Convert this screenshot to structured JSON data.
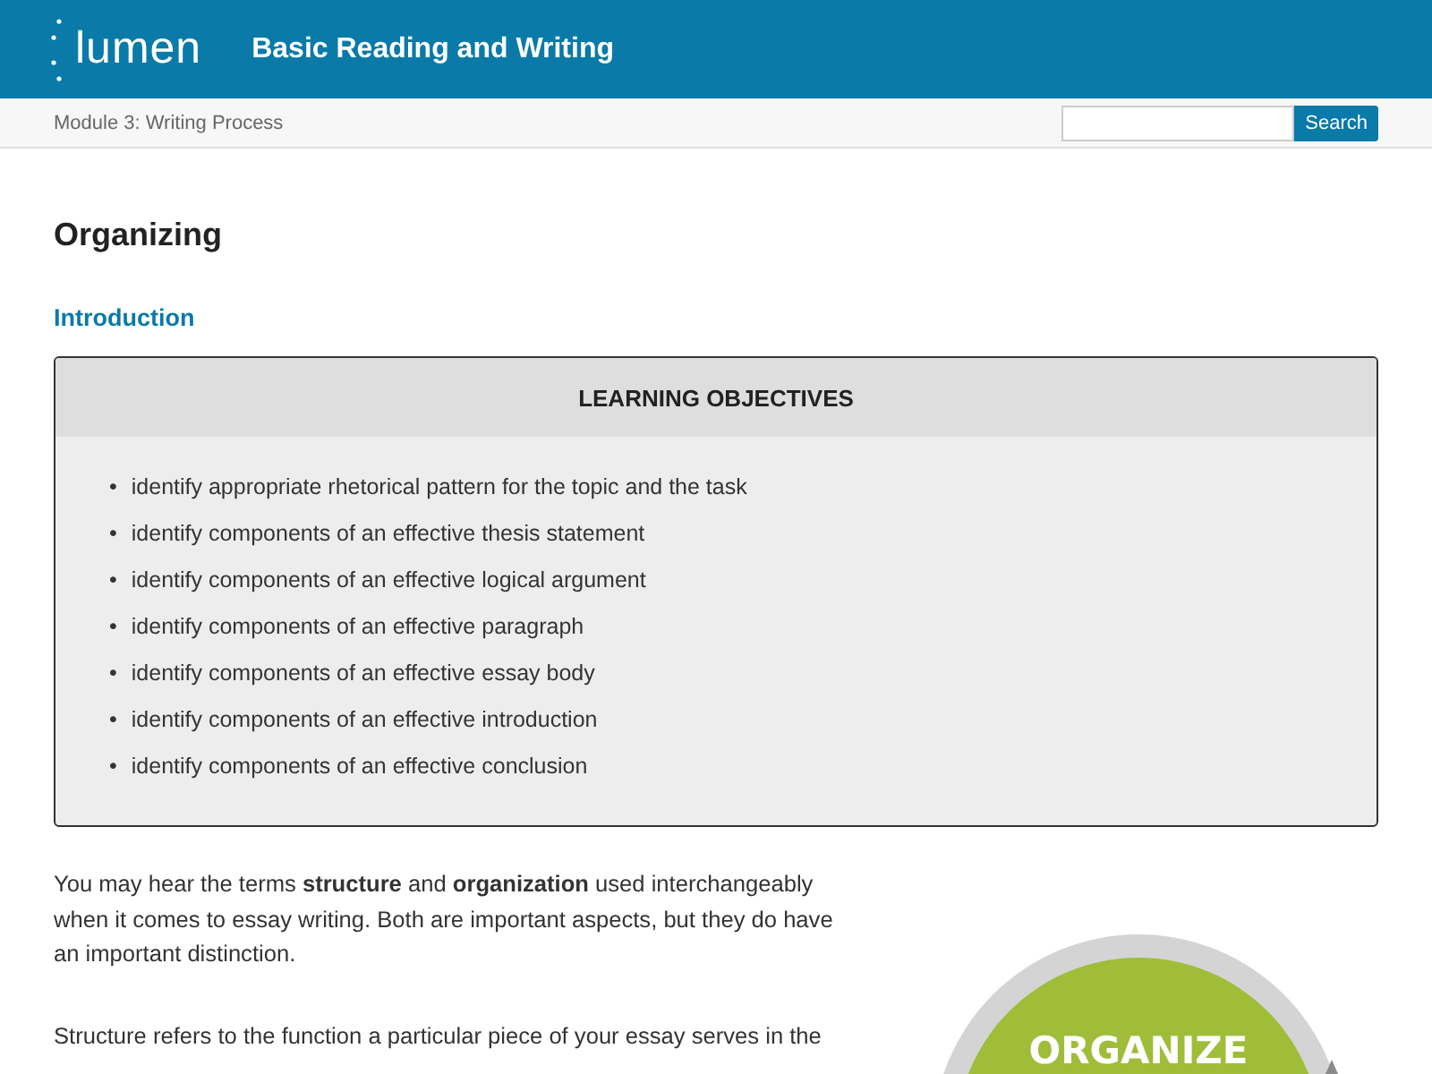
{
  "header": {
    "logo": "lumen",
    "title": "Basic Reading and Writing"
  },
  "breadcrumb": {
    "module": "Module 3: Writing Process",
    "search": {
      "button": "Search"
    }
  },
  "page": {
    "title": "Organizing",
    "section": "Introduction"
  },
  "objectives": {
    "title": "LEARNING OBJECTIVES",
    "items": [
      {
        "marker": "•",
        "text": "identify appropriate rhetorical pattern for the topic and the task"
      },
      {
        "marker": "•",
        "text": "identify components of an effective thesis statement"
      },
      {
        "marker": "•",
        "text": "identify components of an effective logical argument"
      },
      {
        "marker": "•",
        "text": "identify components of an effective paragraph"
      },
      {
        "marker": "•",
        "text": "identify components of an effective essay body"
      },
      {
        "marker": "•",
        "text": "identify components of an effective introduction"
      },
      {
        "marker": "•",
        "text": "identify components of an effective conclusion"
      }
    ]
  },
  "paragraphs": [
    "You may hear the terms **structure** and **organization** used interchangeably when it comes to essay writing.  Both are important aspects, but they do have an important distinction.",
    "Structure refers to the function a particular piece of your essay serves in the"
  ],
  "figure": {
    "label": "ORGANIZE"
  }
}
